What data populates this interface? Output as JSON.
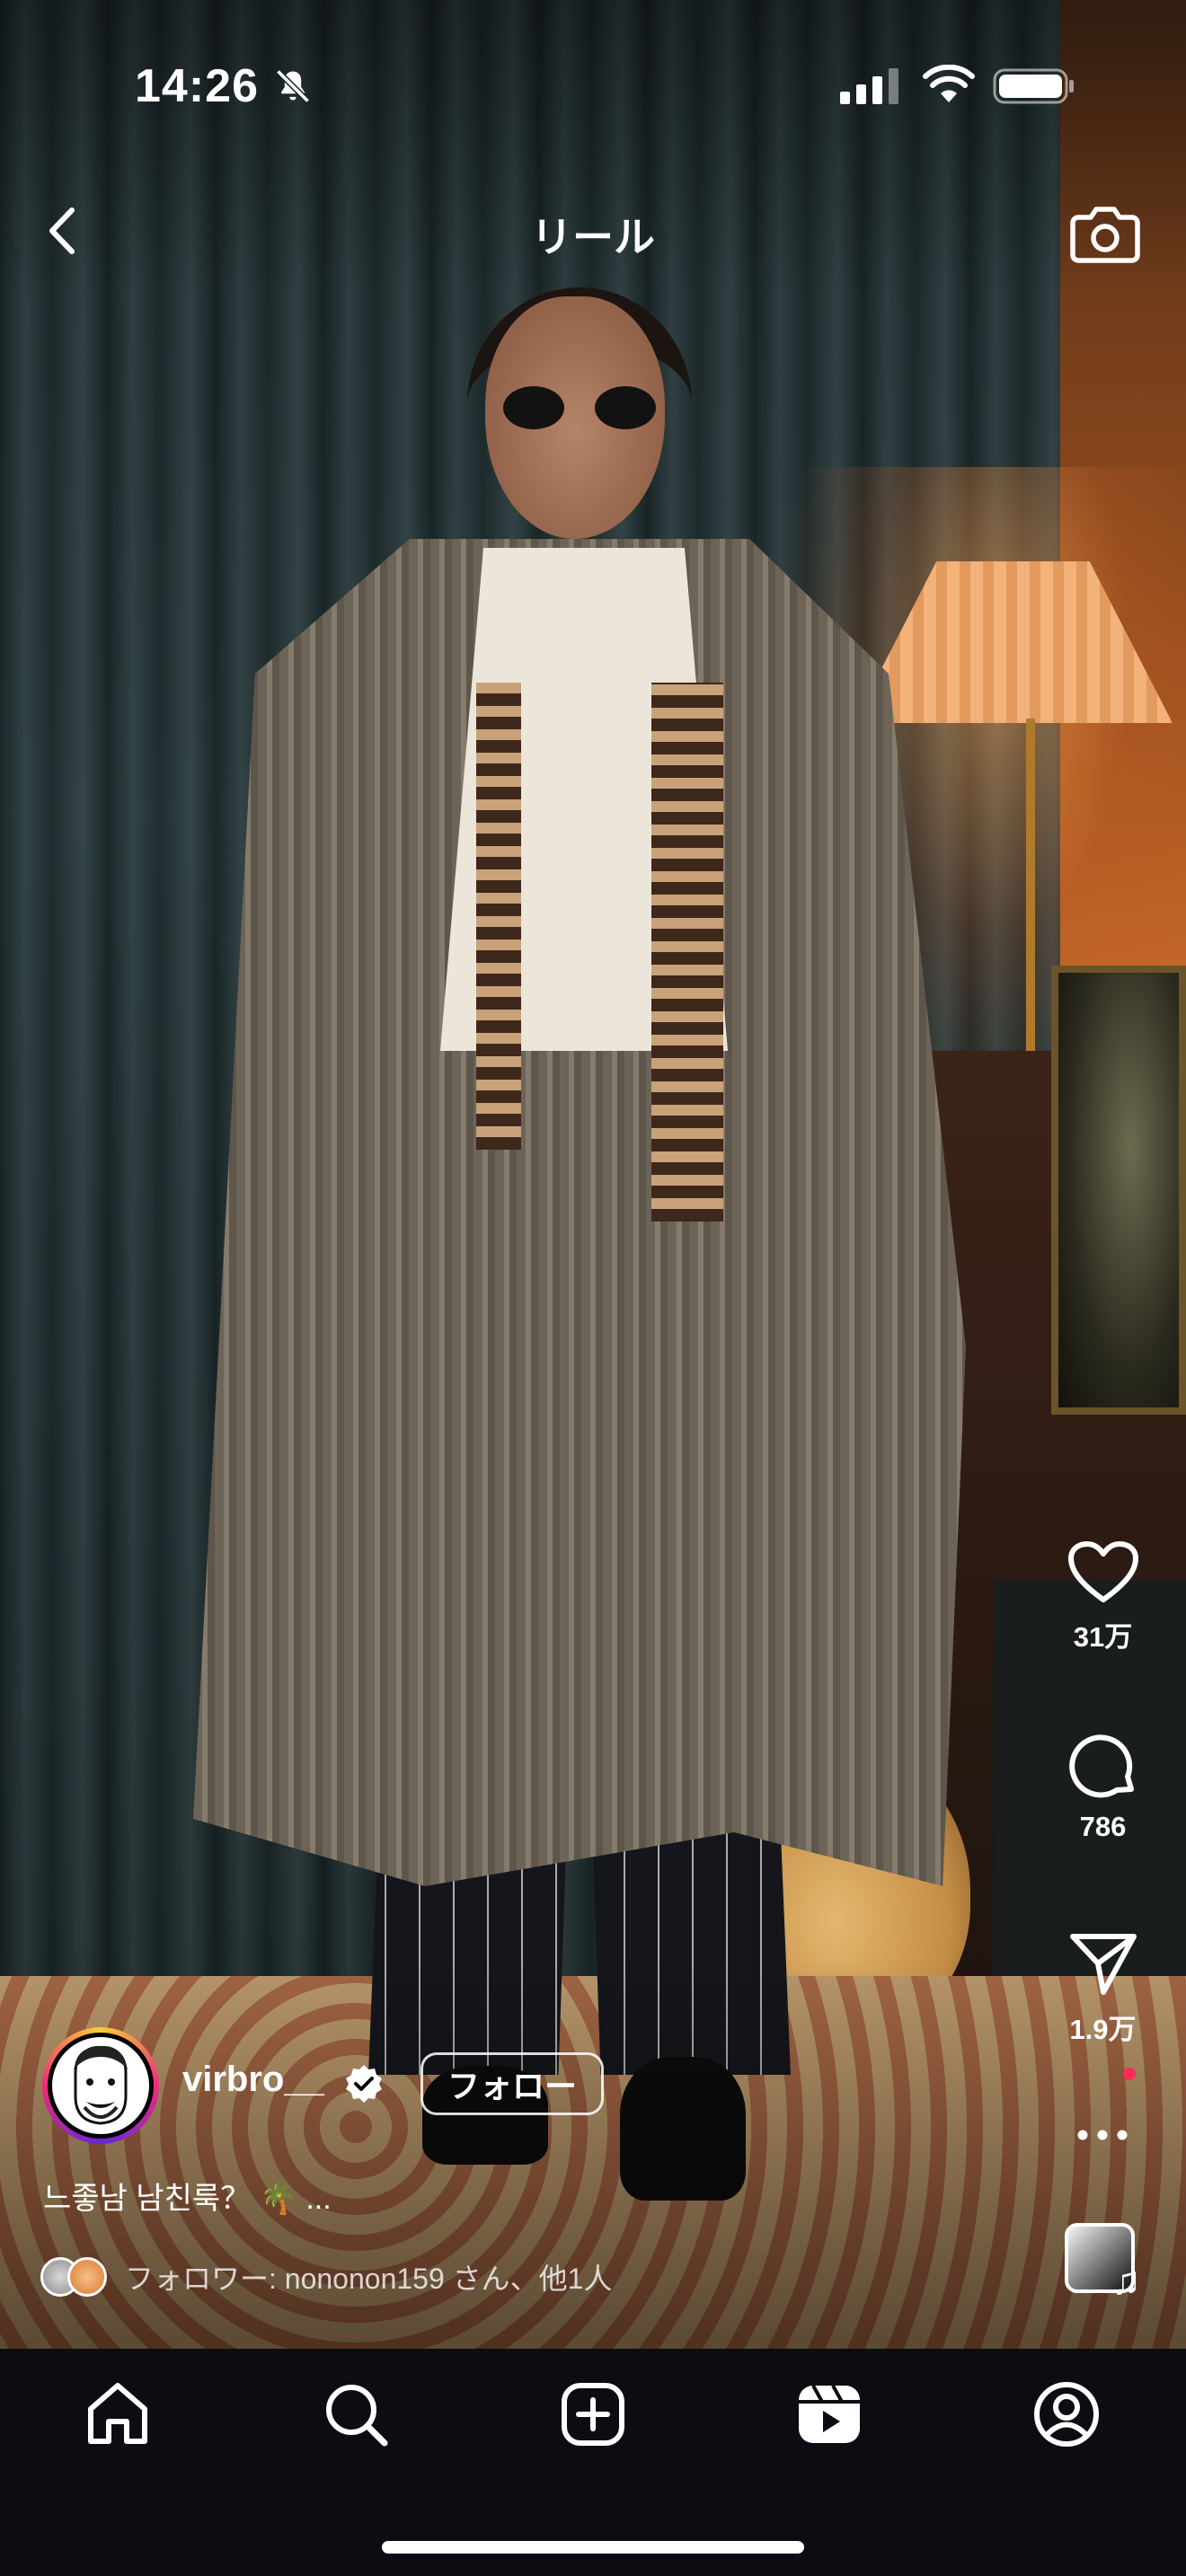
{
  "status_bar": {
    "time": "14:26",
    "icons": [
      "bell-off-icon",
      "signal-icon",
      "wifi-icon",
      "battery-icon"
    ]
  },
  "header": {
    "title": "リール",
    "back_icon": "chevron-left-icon",
    "camera_icon": "camera-icon"
  },
  "actions": {
    "like": {
      "icon": "heart-icon",
      "count": "31万"
    },
    "comment": {
      "icon": "comment-bubble-icon",
      "count": "786"
    },
    "share": {
      "icon": "paper-plane-icon",
      "count": "1.9万"
    },
    "more_icon": "more-horizontal-icon",
    "audio_icon": "music-note-icon",
    "audio_note": "♫"
  },
  "post": {
    "username": "virbro__",
    "verified_icon": "verified-badge-icon",
    "follow_label": "フォロー",
    "caption": "느좋남 남친룩？ 🌴 ...",
    "followed_by": "フォロワー: nononon159 さん、他1人"
  },
  "tabbar": {
    "items": [
      "home-icon",
      "search-icon",
      "create-icon",
      "reels-icon",
      "profile-icon"
    ]
  },
  "colors": {
    "tabbar_bg": "#0b0d13",
    "text": "#ffffff",
    "new_dot": "#ff2d55"
  }
}
